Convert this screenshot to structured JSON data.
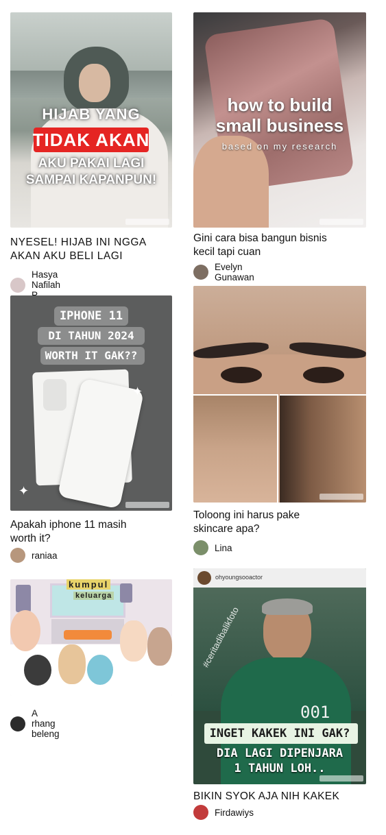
{
  "feed": {
    "cards": [
      {
        "title": "NYESEL! HIJAB INI NGGA AKAN AKU BELI LAGI",
        "author": "Hasya Nafilah P",
        "thumb": {
          "line1": "HIJAB YANG",
          "highlight": "TIDAK AKAN",
          "line3": "AKU PAKAI LAGI",
          "line4": "SAMPAI KAPANPUN!",
          "watermark": "@hasyanp"
        }
      },
      {
        "title": "Gini cara bisa bangun bisnis kecil tapi cuan",
        "author": "Evelyn Gunawan",
        "thumb": {
          "line1": "how to build",
          "line2": "small business",
          "line3": "based on my research",
          "watermark": "@evelyngunawan"
        }
      },
      {
        "title": "Apakah iphone 11 masih worth it?",
        "author": "raniaa",
        "thumb": {
          "line1": "IPHONE 11",
          "line2": "DI TAHUN 2024",
          "line3": "WORTH IT GAK??",
          "watermark": "@rniaqdsy"
        }
      },
      {
        "title": "Toloong ini harus pake skincare apa?",
        "author": "Lina",
        "thumb": {
          "watermark": "@lina2813"
        }
      },
      {
        "title": "",
        "author": "A rhang beleng",
        "thumb": {
          "line1": "kumpul",
          "line2": "keluarga",
          "watermark": "@arhangbeleng"
        }
      },
      {
        "title": "BIKIN SYOK AJA NIH KAKEK",
        "author": "Firdawiys",
        "thumb": {
          "handle": "ohyoungsooactor",
          "hashtag": "#ceritadibalikfoto",
          "number": "001",
          "line1": "INGET KAKEK INI GAK?",
          "line2": "DIA LAGI DIPENJARA",
          "line3": "1 TAHUN LOH..",
          "watermark": "@firdawiys"
        }
      }
    ]
  },
  "colors": {
    "highlight_red": "#e52523",
    "background": "#ffffff",
    "text": "#111111"
  }
}
